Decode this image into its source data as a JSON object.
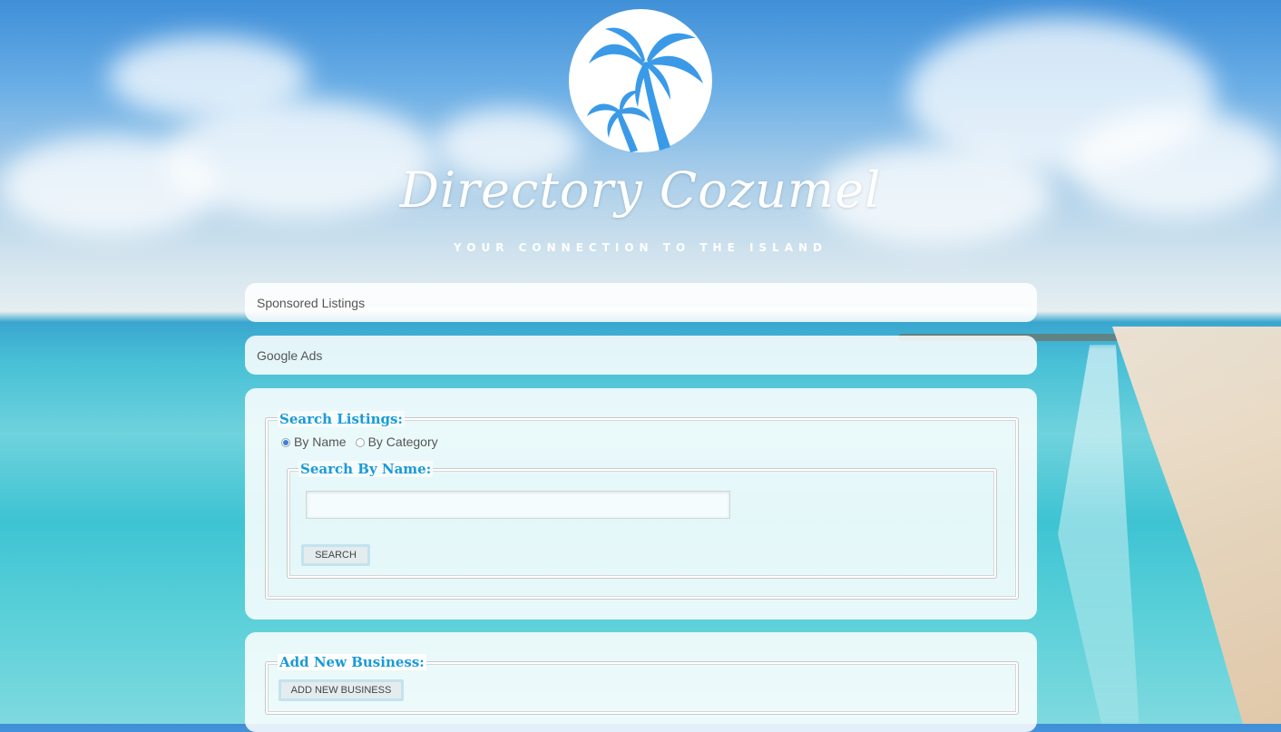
{
  "header": {
    "logo_icon": "palm-tree-icon",
    "title": "Directory Cozumel",
    "tagline": "YOUR CONNECTION TO THE ISLAND"
  },
  "sponsored": {
    "label": "Sponsored Listings"
  },
  "google_ads": {
    "label": "Google Ads"
  },
  "search": {
    "legend": "Search Listings:",
    "options": [
      {
        "label": "By Name",
        "selected": true
      },
      {
        "label": "By Category",
        "selected": false
      }
    ],
    "by_name_legend": "Search By Name:",
    "input_value": "",
    "button_label": "SEARCH"
  },
  "business": {
    "legend": "Add New Business:",
    "button_label": "ADD NEW BUSINESS"
  },
  "colors": {
    "accent": "#1a9bd7",
    "palm": "#3a9ae8"
  }
}
